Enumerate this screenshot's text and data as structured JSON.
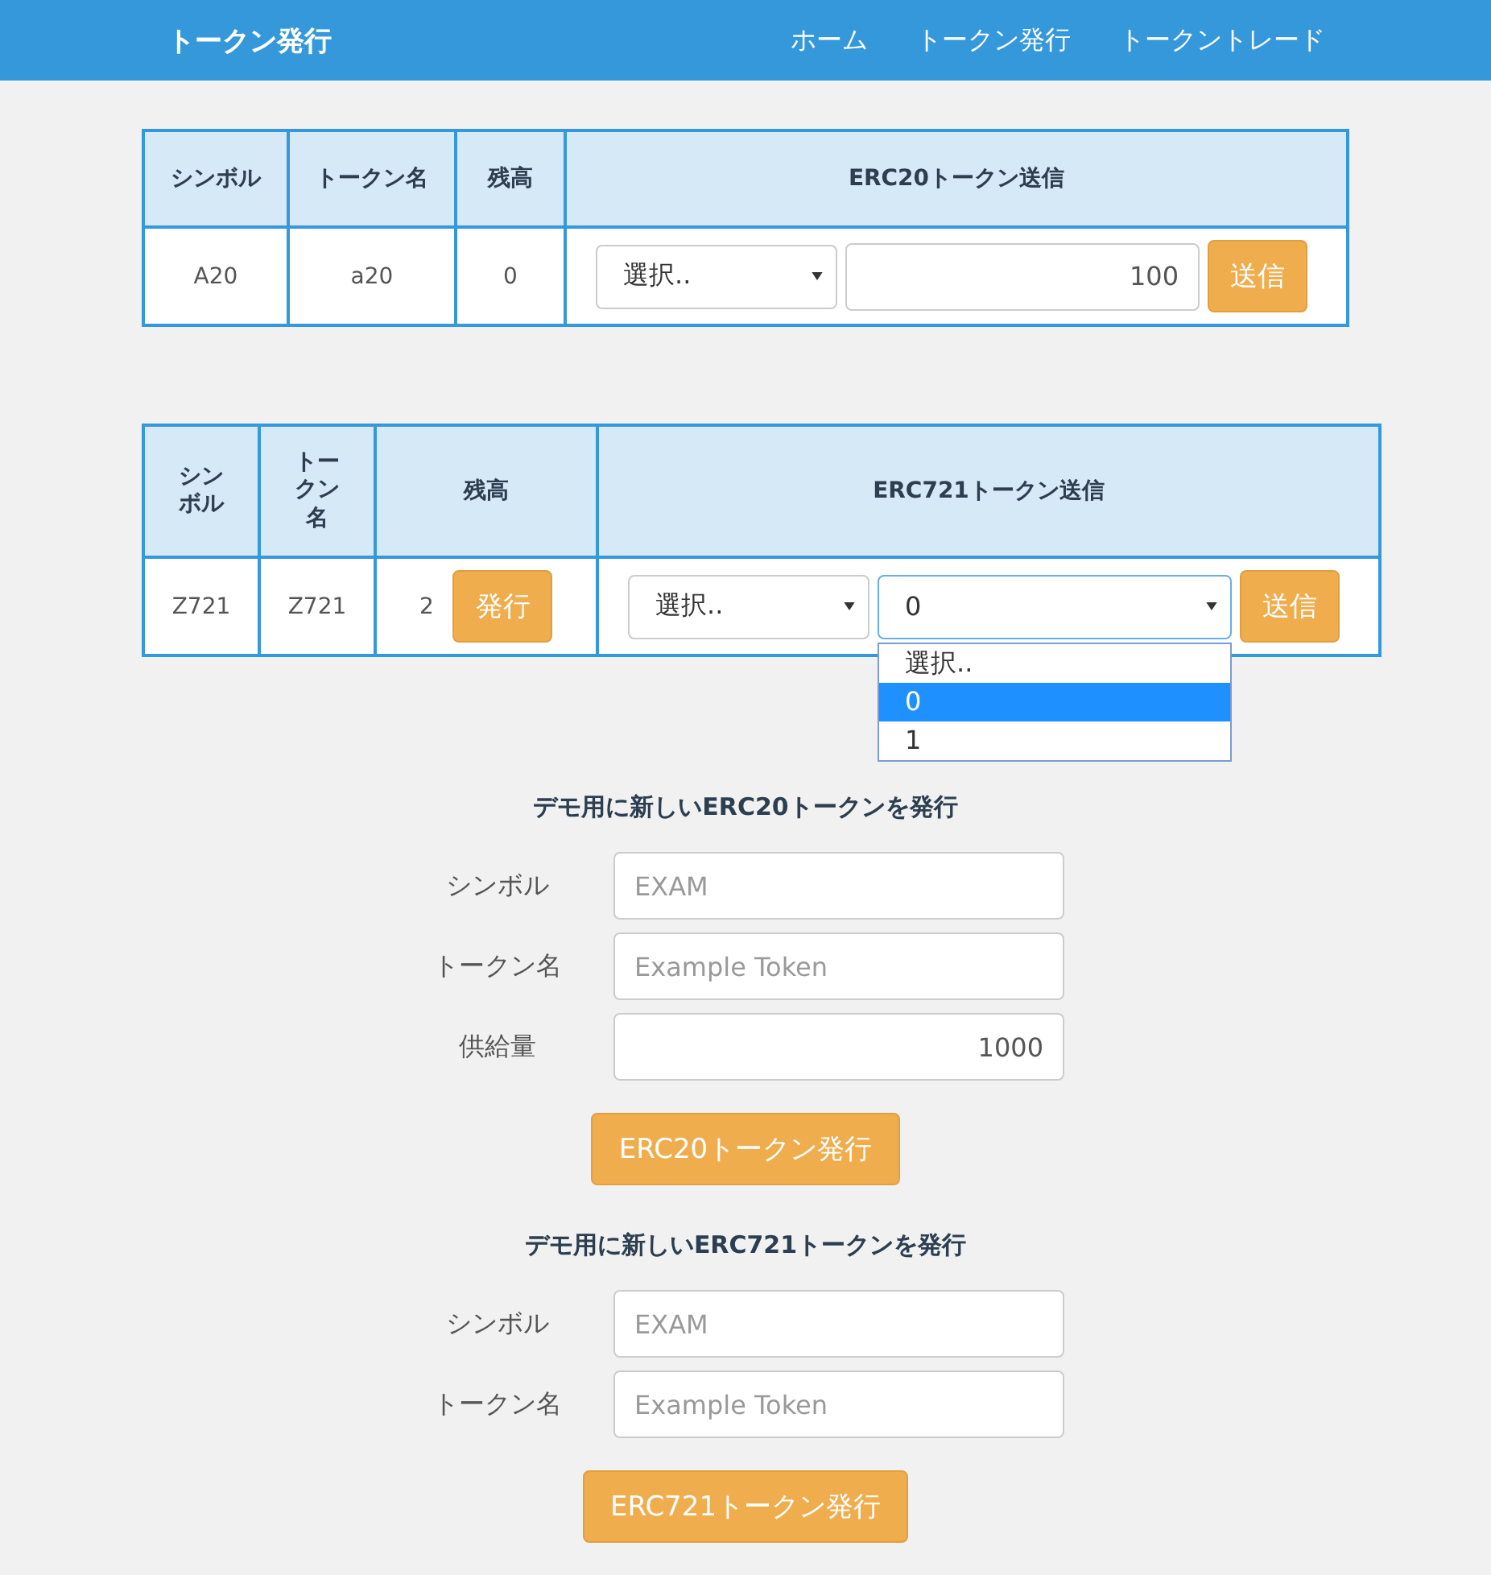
{
  "navbar": {
    "brand": "トークン発行",
    "links": [
      {
        "label": "ホーム"
      },
      {
        "label": "トークン発行"
      },
      {
        "label": "トークントレード"
      }
    ]
  },
  "erc20_table": {
    "columns": [
      "シンボル",
      "トークン名",
      "残高",
      "ERC20トークン送信"
    ],
    "rows": [
      {
        "symbol": "A20",
        "name": "a20",
        "balance": "0",
        "recipient": {
          "value": "選択.."
        },
        "amount": {
          "value": "100"
        },
        "send_button": "送信"
      }
    ]
  },
  "erc721_table": {
    "columns": [
      "シンボル",
      "トークン名",
      "残高",
      "ERC721トークン送信"
    ],
    "rows": [
      {
        "symbol": "Z721",
        "name": "Z721",
        "balance": "2",
        "mint_button": "発行",
        "recipient": {
          "value": "選択.."
        },
        "token_id": {
          "value": "0",
          "expanded": true,
          "options": [
            {
              "label": "選択..",
              "selected": false
            },
            {
              "label": "0",
              "selected": true
            },
            {
              "label": "1",
              "selected": false
            }
          ]
        },
        "send_button": "送信"
      }
    ]
  },
  "erc20_form": {
    "title": "デモ用に新しいERC20トークンを発行",
    "fields": [
      {
        "label": "シンボル",
        "placeholder": "EXAM"
      },
      {
        "label": "トークン名",
        "placeholder": "Example Token"
      },
      {
        "label": "供給量",
        "value": "1000"
      }
    ],
    "button": "ERC20トークン発行"
  },
  "erc721_form": {
    "title": "デモ用に新しいERC721トークンを発行",
    "fields": [
      {
        "label": "シンボル",
        "placeholder": "EXAM"
      },
      {
        "label": "トークン名",
        "placeholder": "Example Token"
      }
    ],
    "button": "ERC721トークン発行"
  }
}
